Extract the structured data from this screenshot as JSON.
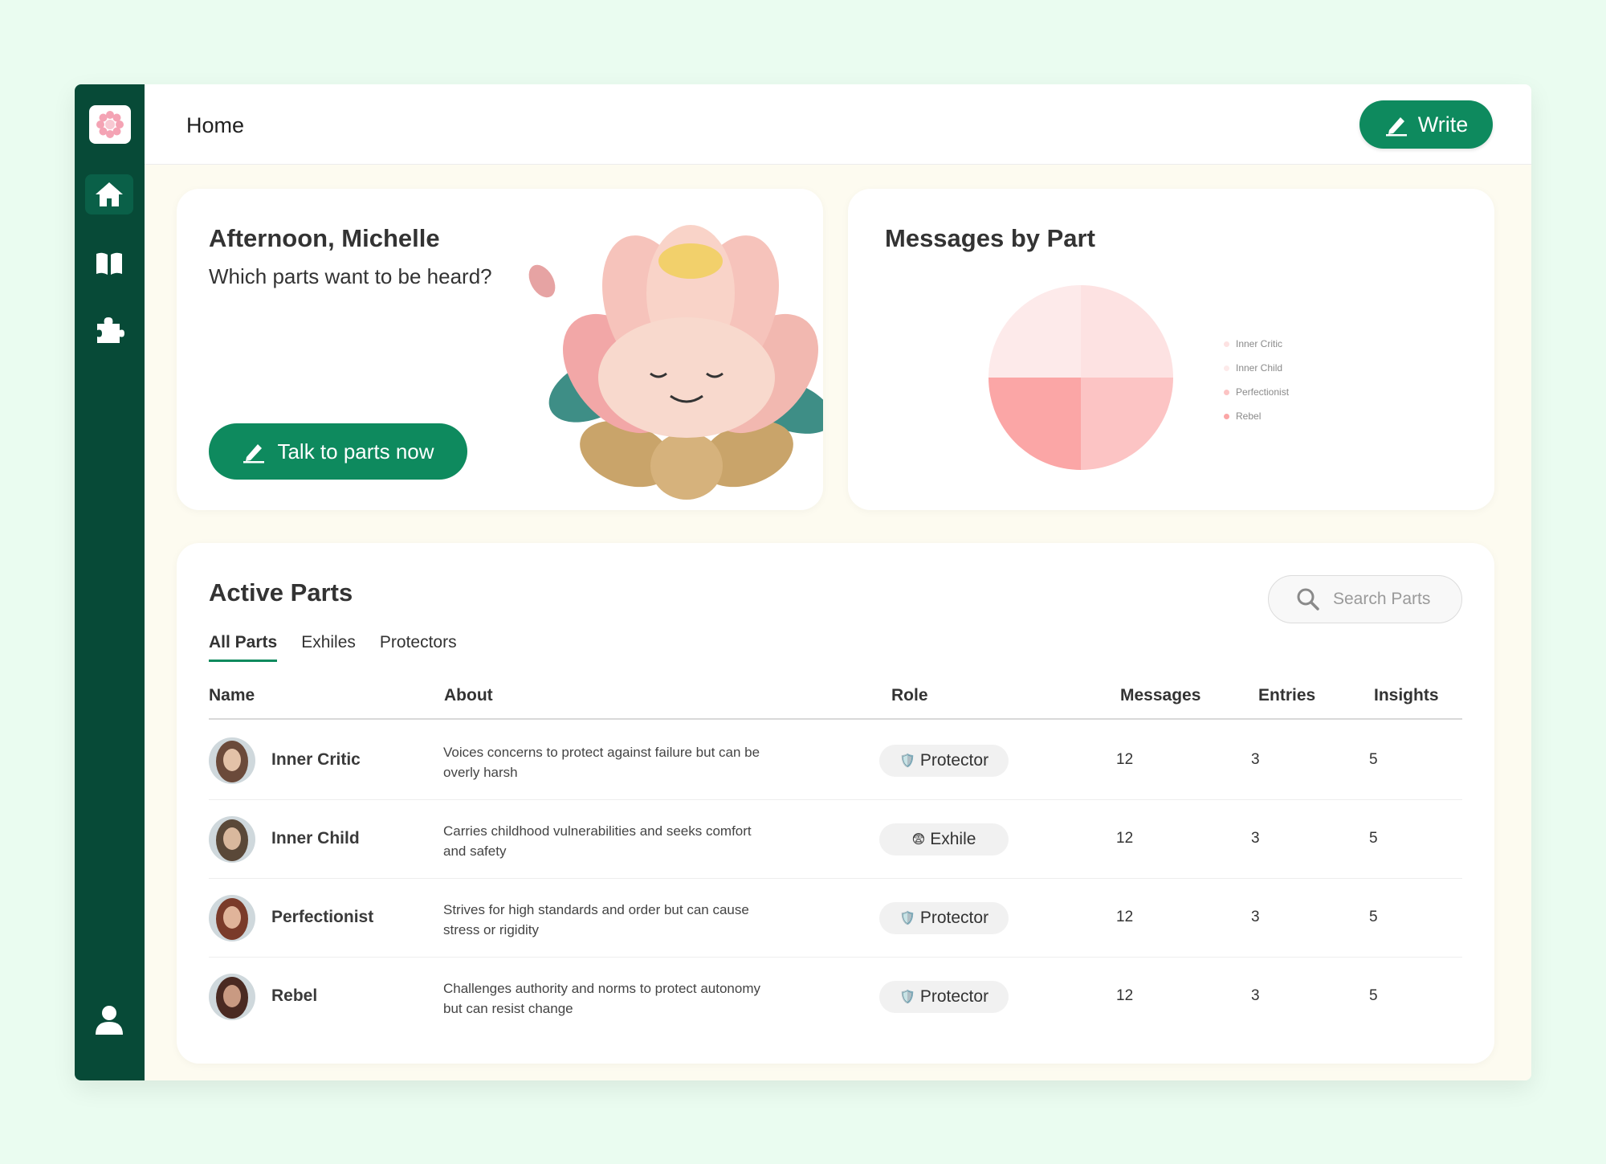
{
  "app": {
    "page_title": "Home",
    "write_label": "Write"
  },
  "sidebar": {
    "items": [
      {
        "name": "home",
        "icon": "home-icon",
        "active": true
      },
      {
        "name": "journal",
        "icon": "book-icon",
        "active": false
      },
      {
        "name": "parts",
        "icon": "puzzle-icon",
        "active": false
      }
    ],
    "profile_icon": "user-icon"
  },
  "greeting": {
    "headline": "Afternoon, Michelle",
    "subline": "Which parts want to be heard?",
    "cta_label": "Talk to parts now"
  },
  "chart": {
    "title": "Messages by Part"
  },
  "chart_data": {
    "type": "pie",
    "title": "Messages by Part",
    "series": [
      {
        "name": "Inner Critic",
        "value": 12,
        "color": "#fde2e2"
      },
      {
        "name": "Inner Child",
        "value": 12,
        "color": "#fdeaea"
      },
      {
        "name": "Perfectionist",
        "value": 12,
        "color": "#fcc4c4"
      },
      {
        "name": "Rebel",
        "value": 12,
        "color": "#fba6a6"
      }
    ],
    "legend": "right"
  },
  "parts": {
    "title": "Active Parts",
    "search_placeholder": "Search Parts",
    "tabs": [
      "All Parts",
      "Exhiles",
      "Protectors"
    ],
    "columns": [
      "Name",
      "About",
      "Role",
      "Messages",
      "Entries",
      "Insights"
    ],
    "rows": [
      {
        "name": "Inner Critic",
        "about": "Voices concerns to protect against failure but can be overly harsh",
        "role_emoji": "🛡️",
        "role": "Protector",
        "messages": "12",
        "entries": "3",
        "insights": "5"
      },
      {
        "name": "Inner Child",
        "about": "Carries childhood vulnerabilities and seeks comfort and safety",
        "role_emoji": "😨",
        "role": "Exhile",
        "messages": "12",
        "entries": "3",
        "insights": "5"
      },
      {
        "name": "Perfectionist",
        "about": "Strives for high standards and order but can cause stress or rigidity",
        "role_emoji": "🛡️",
        "role": "Protector",
        "messages": "12",
        "entries": "3",
        "insights": "5"
      },
      {
        "name": "Rebel",
        "about": "Challenges authority and norms to protect autonomy but can resist change",
        "role_emoji": "🛡️",
        "role": "Protector",
        "messages": "12",
        "entries": "3",
        "insights": "5"
      }
    ]
  },
  "colors": {
    "sidebar": "#074a37",
    "accent": "#0e8a5e",
    "background": "#eafcf0"
  }
}
